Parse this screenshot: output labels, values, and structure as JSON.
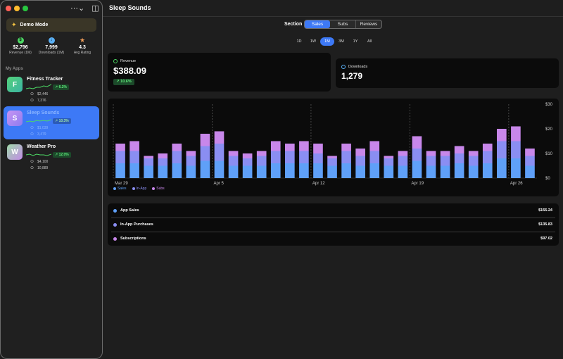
{
  "sidebar": {
    "demo_label": "Demo Mode",
    "stats": [
      {
        "value": "$2,796",
        "label": "Revenue (1M)",
        "icon": "dollar-icon",
        "color": "#4cd964"
      },
      {
        "value": "7,999",
        "label": "Downloads (1M)",
        "icon": "download-icon",
        "color": "#5ab0f5"
      },
      {
        "value": "4.3",
        "label": "Avg Rating",
        "icon": "star-icon",
        "color": "#f5a05a"
      }
    ],
    "section_label": "My Apps",
    "apps": [
      {
        "initial": "F",
        "name": "Fitness Tracker",
        "growth": "↗ 6.2%",
        "revenue": "$2,446",
        "downloads": "7,376",
        "color": "#4cc28a",
        "selected": false
      },
      {
        "initial": "S",
        "name": "Sleep Sounds",
        "growth": "↗ 10.3%",
        "revenue": "$1,039",
        "downloads": "3,479",
        "color": "#b58cf3",
        "selected": true
      },
      {
        "initial": "W",
        "name": "Weather Pro",
        "growth": "↗ 12.0%",
        "revenue": "$4,100",
        "downloads": "10,889",
        "color": "#8fd3a0",
        "selected": false
      }
    ]
  },
  "header": {
    "title": "Sleep Sounds"
  },
  "section": {
    "label": "Section",
    "tabs": [
      "Sales",
      "Subs",
      "Reviews"
    ],
    "active": "Sales"
  },
  "ranges": {
    "items": [
      "1D",
      "1W",
      "1M",
      "3M",
      "1Y",
      "All"
    ],
    "active": "1M"
  },
  "kpis": {
    "revenue": {
      "label": "Revenue",
      "value": "$388.09",
      "badge": "↗ 10.6%"
    },
    "downloads": {
      "label": "Downloads",
      "value": "1,279"
    }
  },
  "chart_data": {
    "type": "bar",
    "stacked": true,
    "categories": [
      "Mar 29",
      "Mar 30",
      "Mar 31",
      "Apr 1",
      "Apr 2",
      "Apr 3",
      "Apr 4",
      "Apr 5",
      "Apr 6",
      "Apr 7",
      "Apr 8",
      "Apr 9",
      "Apr 10",
      "Apr 11",
      "Apr 12",
      "Apr 13",
      "Apr 14",
      "Apr 15",
      "Apr 16",
      "Apr 17",
      "Apr 18",
      "Apr 19",
      "Apr 20",
      "Apr 21",
      "Apr 22",
      "Apr 23",
      "Apr 24",
      "Apr 25",
      "Apr 26",
      "Apr 27"
    ],
    "x_tick_labels": [
      "Mar 29",
      "Apr 5",
      "Apr 12",
      "Apr 19",
      "Apr 26"
    ],
    "series": [
      {
        "name": "Sales",
        "color": "#5fa0f8",
        "values": [
          6,
          6,
          5,
          5,
          6,
          5,
          7,
          7,
          5,
          5,
          5,
          6,
          6,
          6,
          6,
          5,
          6,
          5,
          6,
          5,
          5,
          7,
          5,
          5,
          6,
          5,
          6,
          8,
          8,
          5
        ]
      },
      {
        "name": "In-App",
        "color": "#8a8ef2",
        "values": [
          5,
          5,
          3,
          3,
          5,
          4,
          6,
          7,
          4,
          3,
          4,
          5,
          5,
          5,
          4,
          3,
          5,
          4,
          5,
          3,
          4,
          5,
          4,
          4,
          4,
          4,
          5,
          7,
          7,
          4
        ]
      },
      {
        "name": "Subs",
        "color": "#c887ea",
        "values": [
          3,
          4,
          1,
          2,
          3,
          2,
          5,
          5,
          2,
          2,
          2,
          4,
          3,
          4,
          4,
          1,
          3,
          3,
          4,
          1,
          2,
          5,
          2,
          2,
          3,
          2,
          3,
          5,
          6,
          3
        ]
      }
    ],
    "ylim": [
      0,
      30
    ],
    "y_ticks": [
      "$30",
      "$20",
      "$10",
      "$0"
    ],
    "legend": [
      "Sales",
      "In-App",
      "Subs"
    ],
    "legend_position": "bottom-left",
    "grid": "dashed vertical weekly"
  },
  "breakdown": [
    {
      "label": "App Sales",
      "value": "$155.24",
      "color": "#5fa0f8"
    },
    {
      "label": "In-App Purchases",
      "value": "$135.83",
      "color": "#8a8ef2"
    },
    {
      "label": "Subscriptions",
      "value": "$97.02",
      "color": "#c887ea"
    }
  ]
}
